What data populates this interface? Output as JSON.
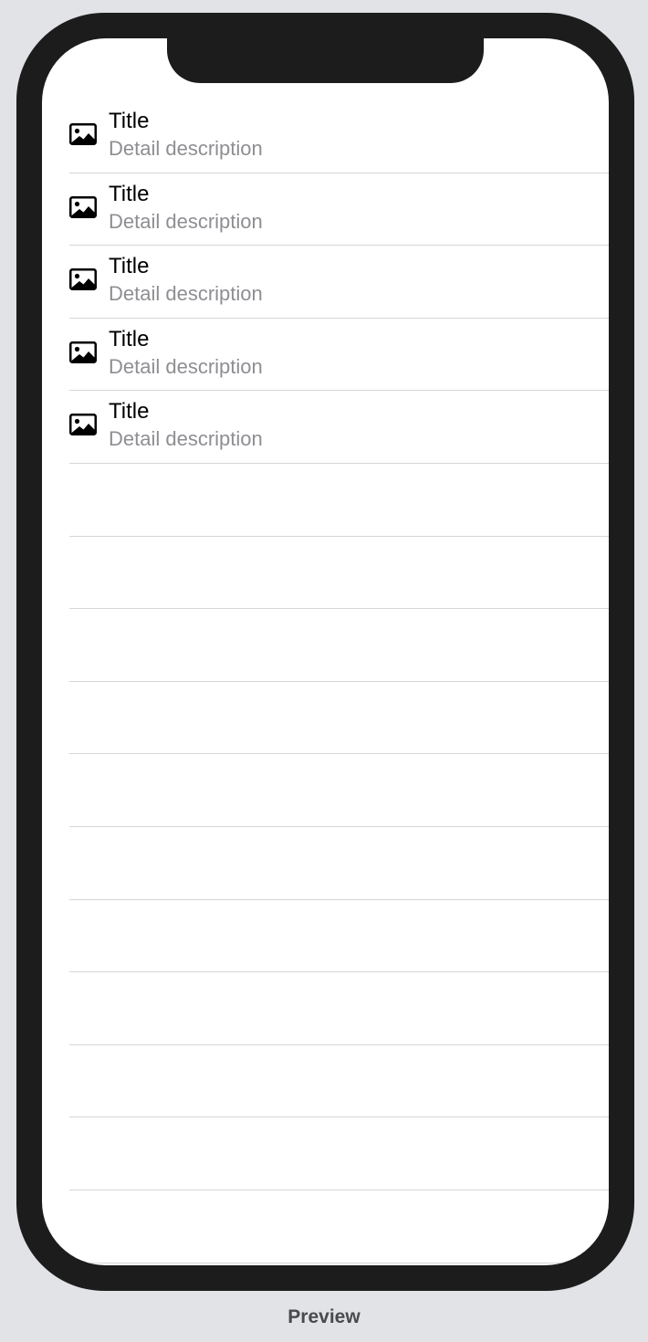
{
  "list": {
    "items": [
      {
        "icon": "photo-icon",
        "title": "Title",
        "detail": "Detail description"
      },
      {
        "icon": "photo-icon",
        "title": "Title",
        "detail": "Detail description"
      },
      {
        "icon": "photo-icon",
        "title": "Title",
        "detail": "Detail description"
      },
      {
        "icon": "photo-icon",
        "title": "Title",
        "detail": "Detail description"
      },
      {
        "icon": "photo-icon",
        "title": "Title",
        "detail": "Detail description"
      }
    ],
    "empty_row_count": 11
  },
  "preview_label": "Preview",
  "colors": {
    "background": "#e2e3e7",
    "device_frame": "#1c1c1c",
    "screen": "#ffffff",
    "separator": "#d6d6d8",
    "detail_text": "#8e8e93"
  }
}
